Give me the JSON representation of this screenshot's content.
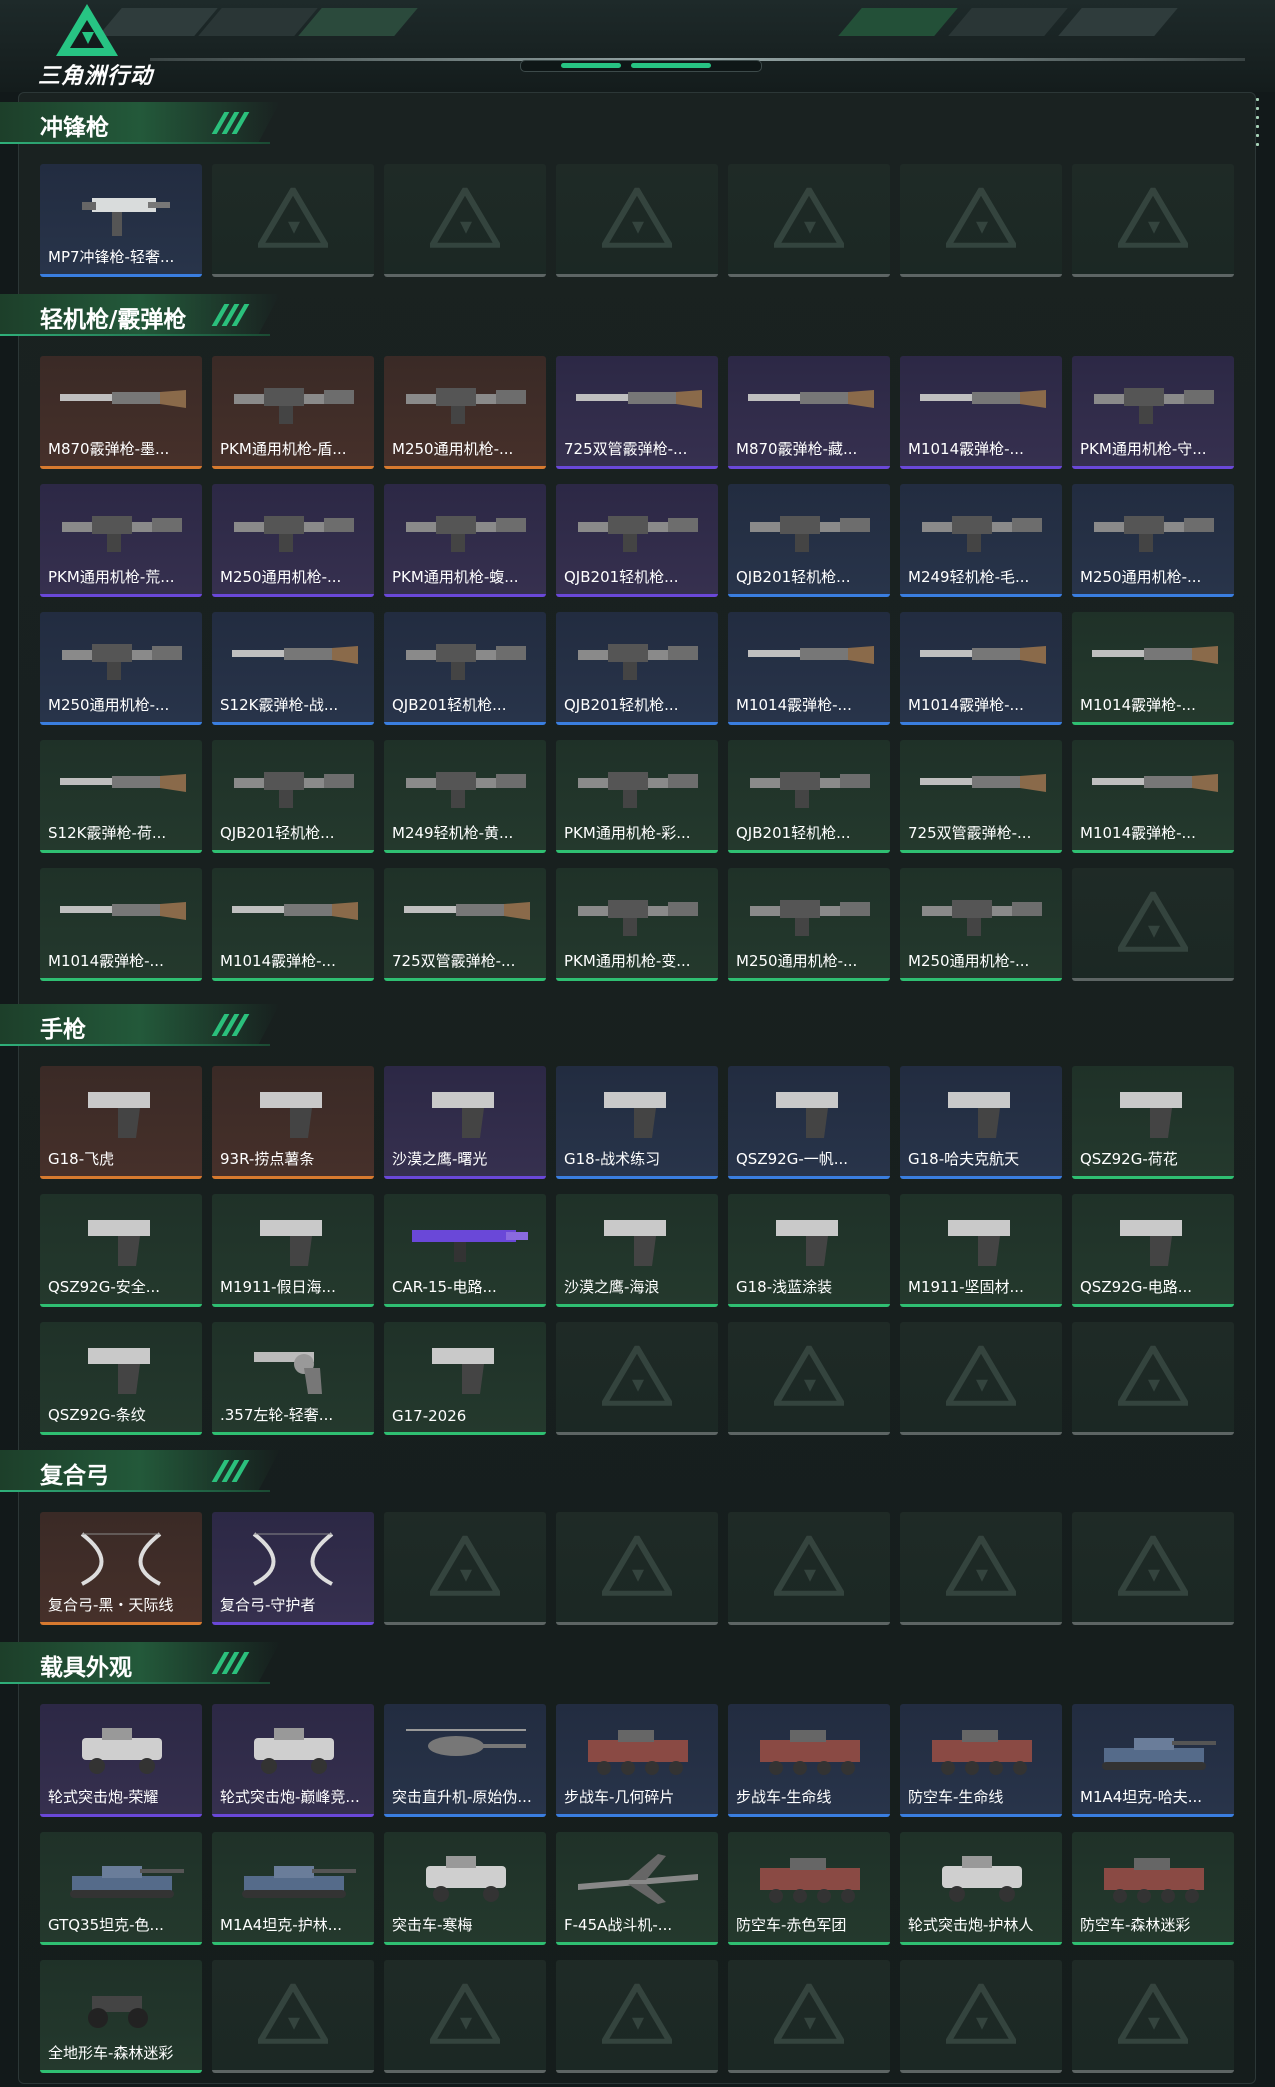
{
  "app": {
    "logo_text": "三角洲行动"
  },
  "colors": {
    "rarity_orange": "#d77a2f",
    "rarity_purple": "#6a48d8",
    "rarity_blue": "#3a7ee0",
    "rarity_green": "#2fbf72",
    "accent": "#27c483"
  },
  "sections": [
    {
      "title": "冲锋枪",
      "items": [
        {
          "label": "MP7冲锋枪-轻奢...",
          "rarity": "blue",
          "icon": "smg-icon"
        }
      ],
      "empty_slots": 6
    },
    {
      "title": "轻机枪/霰弹枪",
      "items": [
        {
          "label": "M870霰弹枪-墨...",
          "rarity": "orange",
          "icon": "shotgun-icon"
        },
        {
          "label": "PKM通用机枪-盾...",
          "rarity": "orange",
          "icon": "machine-gun-icon"
        },
        {
          "label": "M250通用机枪-...",
          "rarity": "orange",
          "icon": "machine-gun-icon"
        },
        {
          "label": "725双管霰弹枪-...",
          "rarity": "purple",
          "icon": "shotgun-icon"
        },
        {
          "label": "M870霰弹枪-藏...",
          "rarity": "purple",
          "icon": "shotgun-icon"
        },
        {
          "label": "M1014霰弹枪-...",
          "rarity": "purple",
          "icon": "shotgun-icon"
        },
        {
          "label": "PKM通用机枪-守...",
          "rarity": "purple",
          "icon": "machine-gun-icon"
        },
        {
          "label": "PKM通用机枪-荒...",
          "rarity": "purple",
          "icon": "machine-gun-icon"
        },
        {
          "label": "M250通用机枪-...",
          "rarity": "purple",
          "icon": "machine-gun-icon"
        },
        {
          "label": "PKM通用机枪-蝮...",
          "rarity": "purple",
          "icon": "machine-gun-icon"
        },
        {
          "label": "QJB201轻机枪...",
          "rarity": "purple",
          "icon": "machine-gun-icon"
        },
        {
          "label": "QJB201轻机枪...",
          "rarity": "blue",
          "icon": "machine-gun-icon"
        },
        {
          "label": "M249轻机枪-毛...",
          "rarity": "blue",
          "icon": "machine-gun-icon"
        },
        {
          "label": "M250通用机枪-...",
          "rarity": "blue",
          "icon": "machine-gun-icon"
        },
        {
          "label": "M250通用机枪-...",
          "rarity": "blue",
          "icon": "machine-gun-icon"
        },
        {
          "label": "S12K霰弹枪-战...",
          "rarity": "blue",
          "icon": "shotgun-icon"
        },
        {
          "label": "QJB201轻机枪...",
          "rarity": "blue",
          "icon": "machine-gun-icon"
        },
        {
          "label": "QJB201轻机枪...",
          "rarity": "blue",
          "icon": "machine-gun-icon"
        },
        {
          "label": "M1014霰弹枪-...",
          "rarity": "blue",
          "icon": "shotgun-icon"
        },
        {
          "label": "M1014霰弹枪-...",
          "rarity": "blue",
          "icon": "shotgun-icon"
        },
        {
          "label": "M1014霰弹枪-...",
          "rarity": "green",
          "icon": "shotgun-icon"
        },
        {
          "label": "S12K霰弹枪-荷...",
          "rarity": "green",
          "icon": "shotgun-icon"
        },
        {
          "label": "QJB201轻机枪...",
          "rarity": "green",
          "icon": "machine-gun-icon"
        },
        {
          "label": "M249轻机枪-黄...",
          "rarity": "green",
          "icon": "machine-gun-icon"
        },
        {
          "label": "PKM通用机枪-彩...",
          "rarity": "green",
          "icon": "machine-gun-icon"
        },
        {
          "label": "QJB201轻机枪...",
          "rarity": "green",
          "icon": "machine-gun-icon"
        },
        {
          "label": "725双管霰弹枪-...",
          "rarity": "green",
          "icon": "shotgun-icon"
        },
        {
          "label": "M1014霰弹枪-...",
          "rarity": "green",
          "icon": "shotgun-icon"
        },
        {
          "label": "M1014霰弹枪-...",
          "rarity": "green",
          "icon": "shotgun-icon"
        },
        {
          "label": "M1014霰弹枪-...",
          "rarity": "green",
          "icon": "shotgun-icon"
        },
        {
          "label": "725双管霰弹枪-...",
          "rarity": "green",
          "icon": "shotgun-icon"
        },
        {
          "label": "PKM通用机枪-变...",
          "rarity": "green",
          "icon": "machine-gun-icon"
        },
        {
          "label": "M250通用机枪-...",
          "rarity": "green",
          "icon": "machine-gun-icon"
        },
        {
          "label": "M250通用机枪-...",
          "rarity": "green",
          "icon": "machine-gun-icon"
        }
      ],
      "empty_slots": 1
    },
    {
      "title": "手枪",
      "items": [
        {
          "label": "G18-飞虎",
          "rarity": "orange",
          "icon": "pistol-icon"
        },
        {
          "label": "93R-捞点薯条",
          "rarity": "orange",
          "icon": "pistol-icon"
        },
        {
          "label": "沙漠之鹰-曙光",
          "rarity": "purple",
          "icon": "pistol-icon"
        },
        {
          "label": "G18-战术练习",
          "rarity": "blue",
          "icon": "pistol-icon"
        },
        {
          "label": "QSZ92G-一帆...",
          "rarity": "blue",
          "icon": "pistol-icon"
        },
        {
          "label": "G18-哈夫克航天",
          "rarity": "blue",
          "icon": "pistol-icon"
        },
        {
          "label": "QSZ92G-荷花",
          "rarity": "green",
          "icon": "pistol-icon"
        },
        {
          "label": "QSZ92G-安全...",
          "rarity": "green",
          "icon": "pistol-icon"
        },
        {
          "label": "M1911-假日海...",
          "rarity": "green",
          "icon": "pistol-icon"
        },
        {
          "label": "CAR-15-电路...",
          "rarity": "green",
          "icon": "rifle-icon"
        },
        {
          "label": "沙漠之鹰-海浪",
          "rarity": "green",
          "icon": "pistol-icon"
        },
        {
          "label": "G18-浅蓝涂装",
          "rarity": "green",
          "icon": "pistol-icon"
        },
        {
          "label": "M1911-坚固材...",
          "rarity": "green",
          "icon": "pistol-icon"
        },
        {
          "label": "QSZ92G-电路...",
          "rarity": "green",
          "icon": "pistol-icon"
        },
        {
          "label": "QSZ92G-条纹",
          "rarity": "green",
          "icon": "pistol-icon"
        },
        {
          "label": ".357左轮-轻奢...",
          "rarity": "green",
          "icon": "revolver-icon"
        },
        {
          "label": "G17-2026",
          "rarity": "green",
          "icon": "pistol-icon"
        }
      ],
      "empty_slots": 4
    },
    {
      "title": "复合弓",
      "items": [
        {
          "label": "复合弓-黑・天际线",
          "rarity": "orange",
          "icon": "bow-icon"
        },
        {
          "label": "复合弓-守护者",
          "rarity": "purple",
          "icon": "bow-icon"
        }
      ],
      "empty_slots": 5
    },
    {
      "title": "载具外观",
      "items": [
        {
          "label": "轮式突击炮-荣耀",
          "rarity": "purple",
          "icon": "armored-car-icon"
        },
        {
          "label": "轮式突击炮-巅峰竞...",
          "rarity": "purple",
          "icon": "armored-car-icon"
        },
        {
          "label": "突击直升机-原始伪...",
          "rarity": "blue",
          "icon": "helicopter-icon"
        },
        {
          "label": "步战车-几何碎片",
          "rarity": "blue",
          "icon": "ifv-icon"
        },
        {
          "label": "步战车-生命线",
          "rarity": "blue",
          "icon": "ifv-icon"
        },
        {
          "label": "防空车-生命线",
          "rarity": "blue",
          "icon": "ifv-icon"
        },
        {
          "label": "M1A4坦克-哈夫...",
          "rarity": "blue",
          "icon": "tank-icon"
        },
        {
          "label": "GTQ35坦克-色...",
          "rarity": "green",
          "icon": "tank-icon"
        },
        {
          "label": "M1A4坦克-护林...",
          "rarity": "green",
          "icon": "tank-icon"
        },
        {
          "label": "突击车-寒梅",
          "rarity": "green",
          "icon": "armored-car-icon"
        },
        {
          "label": "F-45A战斗机-...",
          "rarity": "green",
          "icon": "jet-icon"
        },
        {
          "label": "防空车-赤色军团",
          "rarity": "green",
          "icon": "ifv-icon"
        },
        {
          "label": "轮式突击炮-护林人",
          "rarity": "green",
          "icon": "armored-car-icon"
        },
        {
          "label": "防空车-森林迷彩",
          "rarity": "green",
          "icon": "ifv-icon"
        },
        {
          "label": "全地形车-森林迷彩",
          "rarity": "green",
          "icon": "atv-icon"
        }
      ],
      "empty_slots": 6
    }
  ]
}
